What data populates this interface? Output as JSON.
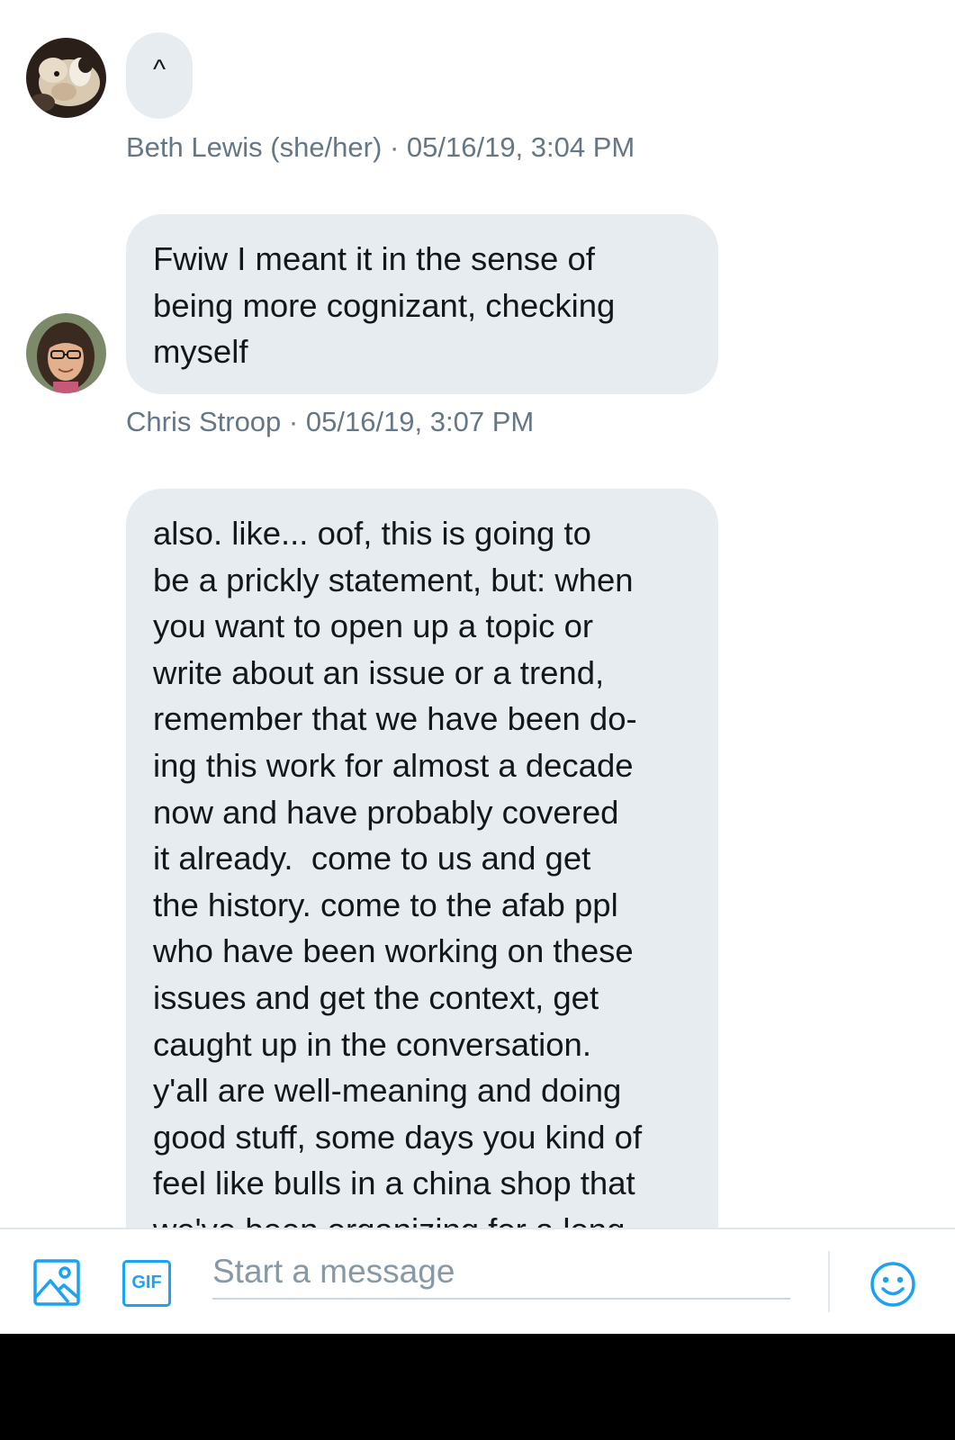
{
  "messages": [
    {
      "avatar_icon": "dog-avatar-icon",
      "text": "^",
      "sender": "Beth Lewis (she/her)",
      "separator": "·",
      "time": "05/16/19, 3:04 PM"
    },
    {
      "avatar_icon": "person-avatar-icon",
      "text": "Fwiw I meant it in the sense of\nbeing more cognizant, checking\nmyself",
      "sender": "Chris Stroop",
      "separator": "·",
      "time": "05/16/19, 3:07 PM"
    },
    {
      "text": "also. like... oof, this is going to\nbe a prickly statement, but: when\nyou want to open up a topic or\nwrite about an issue or a trend,\nremember that we have been do-\ning this work for almost a decade\nnow and have probably covered\nit already.  come to us and get\nthe history. come to the afab ppl\nwho have been working on these\nissues and get the context, get\ncaught up in the conversation.\ny'all are well-meaning and doing\ngood stuff, some days you kind of\nfeel like bulls in a china shop that\nwe've been organizing for a long"
    }
  ],
  "composer": {
    "media_icon": "image-icon",
    "gif_label": "GIF",
    "placeholder": "Start a message",
    "emoji_icon": "emoji-icon"
  },
  "colors": {
    "bubble": "#e6ecf0",
    "meta_text": "#657786",
    "accent": "#1da1f2"
  }
}
